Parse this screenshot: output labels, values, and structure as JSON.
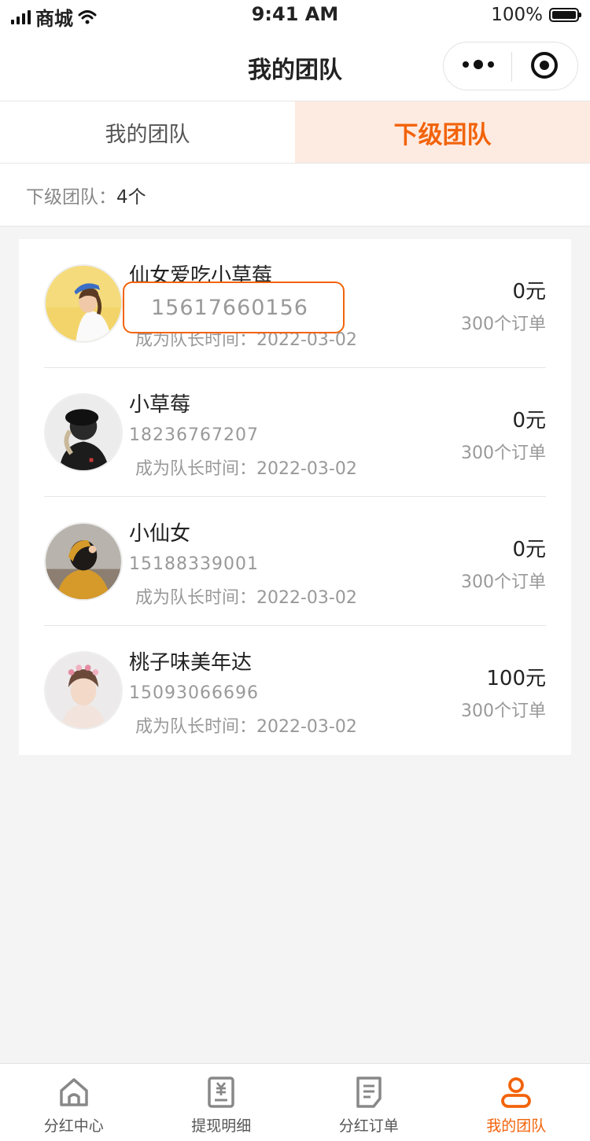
{
  "status_bar": {
    "carrier": "商城",
    "time": "9:41 AM",
    "battery": "100%"
  },
  "nav": {
    "title": "我的团队"
  },
  "tabs": [
    {
      "label": "我的团队",
      "active": false
    },
    {
      "label": "下级团队",
      "active": true
    }
  ],
  "summary": {
    "label": "下级团队：",
    "count": "4个"
  },
  "members": [
    {
      "name": "仙女爱吃小草莓",
      "phone": "",
      "leader_time": "成为队长时间：2022-03-02",
      "amount": "0元",
      "orders": "300个订单",
      "avatar": "woman-blue-cap"
    },
    {
      "name": "小草莓",
      "phone": "18236767207",
      "leader_time": "成为队长时间：2022-03-02",
      "amount": "0元",
      "orders": "300个订单",
      "avatar": "woman-black-hat"
    },
    {
      "name": "小仙女",
      "phone": "15188339001",
      "leader_time": "成为队长时间：2022-03-02",
      "amount": "0元",
      "orders": "300个订单",
      "avatar": "woman-yellow-sweater"
    },
    {
      "name": "桃子味美年达",
      "phone": "15093066696",
      "leader_time": "成为队长时间：2022-03-02",
      "amount": "100元",
      "orders": "300个订单",
      "avatar": "woman-flower-crown"
    }
  ],
  "phone_popup": {
    "value": "15617660156"
  },
  "tabbar": [
    {
      "label": "分红中心",
      "icon": "home-icon",
      "active": false
    },
    {
      "label": "提现明细",
      "icon": "withdraw-icon",
      "active": false
    },
    {
      "label": "分红订单",
      "icon": "order-icon",
      "active": false
    },
    {
      "label": "我的团队",
      "icon": "team-icon",
      "active": true
    }
  ],
  "colors": {
    "accent": "#f2630a",
    "active_tab_bg": "#fdebe1",
    "page_bg": "#f4f4f4"
  }
}
